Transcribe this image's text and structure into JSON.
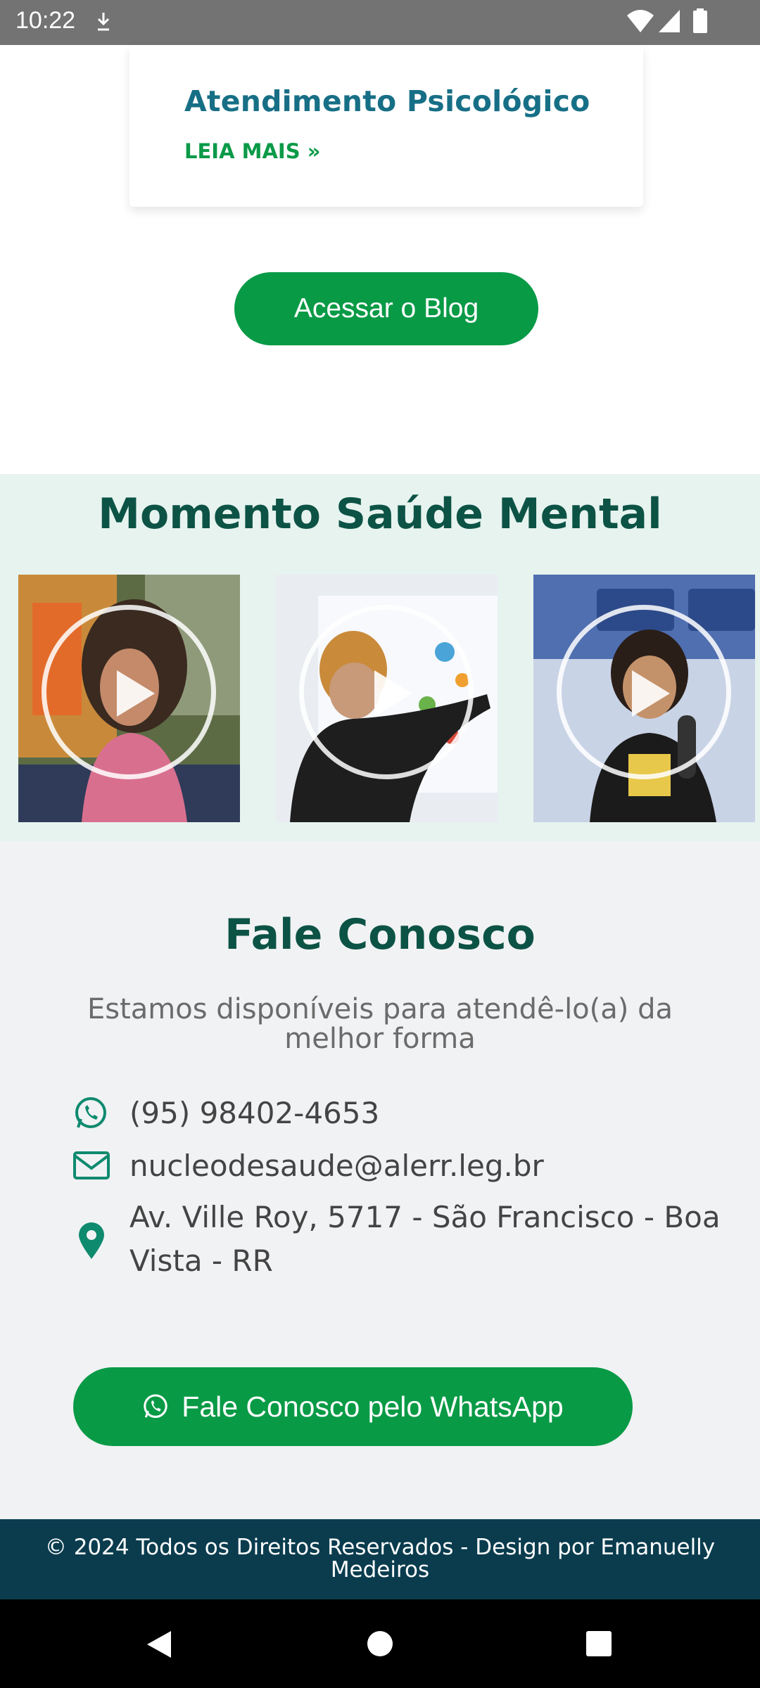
{
  "status_bar": {
    "time": "10:22"
  },
  "blog_card": {
    "title": "Atendimento Psicológico",
    "link": "LEIA MAIS »"
  },
  "blog_button": {
    "label": "Acessar o Blog"
  },
  "momento": {
    "title": "Momento Saúde Mental",
    "videos": [
      {
        "name": "video-1"
      },
      {
        "name": "video-2"
      },
      {
        "name": "video-3"
      }
    ]
  },
  "contact": {
    "title": "Fale Conosco",
    "subtitle": "Estamos disponíveis para atendê-lo(a) da melhor forma",
    "phone": "(95) 98402-4653",
    "email": "nucleodesaude@alerr.leg.br",
    "address_line1": "Av. Ville Roy, 5717 - São Francisco - Boa",
    "address_line2": "Vista - RR",
    "whatsapp_button": "Fale Conosco pelo WhatsApp"
  },
  "footer": {
    "text": "© 2024 Todos os Direitos Reservados - Design por Emanuelly Medeiros"
  },
  "colors": {
    "primary_green": "#099a46",
    "dark_teal": "#0c5345",
    "footer_bg": "#0a3c4e",
    "card_title": "#176f86"
  },
  "icons": [
    "download-icon",
    "wifi-icon",
    "signal-icon",
    "battery-icon",
    "play-icon",
    "whatsapp-icon",
    "email-icon",
    "location-pin-icon",
    "back-icon",
    "home-icon",
    "recents-icon"
  ]
}
